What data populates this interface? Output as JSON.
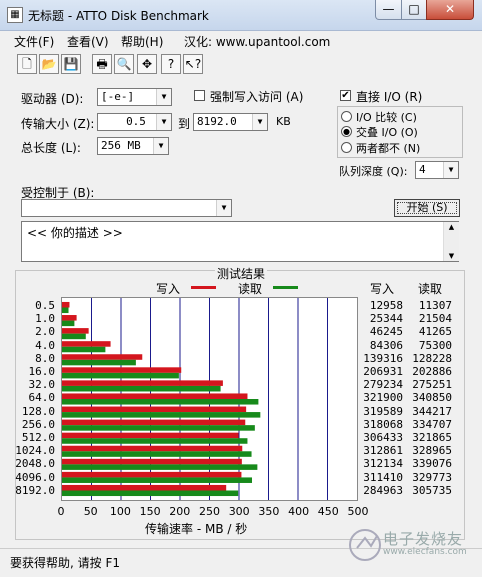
{
  "window": {
    "title": "无标题 - ATTO Disk Benchmark",
    "min": "—",
    "max": "□",
    "close": "✕"
  },
  "menu": [
    "文件(F)",
    "查看(V)",
    "帮助(H)",
    "汉化: www.upantool.com"
  ],
  "toolbar": {
    "icons": [
      "new-icon",
      "open-icon",
      "save-icon",
      "print-icon",
      "print-preview-icon",
      "move-icon",
      "help-icon",
      "context-help-icon"
    ],
    "glyphs": [
      "🗋",
      "📂",
      "💾",
      "🖶",
      "🔍",
      "✥",
      "?",
      "↖?"
    ]
  },
  "form": {
    "drive_label": "驱动器 (D):",
    "drive_value": "[-e-]",
    "force_write_label": "强制写入访问 (A)",
    "transfer_label": "传输大小 (Z):",
    "transfer_from": "0.5",
    "to_label": "到",
    "transfer_to": "8192.0",
    "kb_label": "KB",
    "length_label": "总长度 (L):",
    "length_value": "256 MB",
    "direct_io_label": "直接 I/O (R)",
    "direct_io_checked": "✔",
    "io_compare_label": "I/O 比较 (C)",
    "overlapped_io_label": "交叠 I/O (O)",
    "neither_label": "两者都不 (N)",
    "radio_selected_glyph": "●",
    "queue_label": "队列深度 (Q):",
    "queue_value": "4",
    "controlled_by_label": "受控制于 (B):",
    "controlled_by_value": "",
    "start_label": "开始 (S)",
    "description_text": "<<   你的描述    >>"
  },
  "results": {
    "title": "测试结果",
    "write_label": "写入",
    "read_label": "读取",
    "write_col": "写入",
    "read_col": "读取",
    "xlabel": "传输速率 - MB / 秒",
    "write_color": "#d4161e",
    "read_color": "#178a1b"
  },
  "chart_data": {
    "type": "bar",
    "categories": [
      "0.5",
      "1.0",
      "2.0",
      "4.0",
      "8.0",
      "16.0",
      "32.0",
      "64.0",
      "128.0",
      "256.0",
      "512.0",
      "1024.0",
      "2048.0",
      "4096.0",
      "8192.0"
    ],
    "series": [
      {
        "name": "写入",
        "values": [
          12958,
          25344,
          46245,
          84306,
          139316,
          206931,
          279234,
          321900,
          319589,
          318068,
          306433,
          312861,
          312134,
          311410,
          284963
        ]
      },
      {
        "name": "读取",
        "values": [
          11307,
          21504,
          41265,
          75300,
          128228,
          202886,
          275251,
          340850,
          344217,
          334707,
          321865,
          328965,
          339076,
          329773,
          305735
        ]
      }
    ],
    "xlim": [
      0,
      500
    ],
    "xticks": [
      "0",
      "50",
      "100",
      "150",
      "200",
      "250",
      "300",
      "350",
      "400",
      "450",
      "500"
    ],
    "units": "KB/s plotted as MB/s"
  },
  "status": {
    "text": "要获得帮助, 请按 F1"
  },
  "watermark": {
    "text": "电子发烧友",
    "url": "www.elecfans.com"
  }
}
